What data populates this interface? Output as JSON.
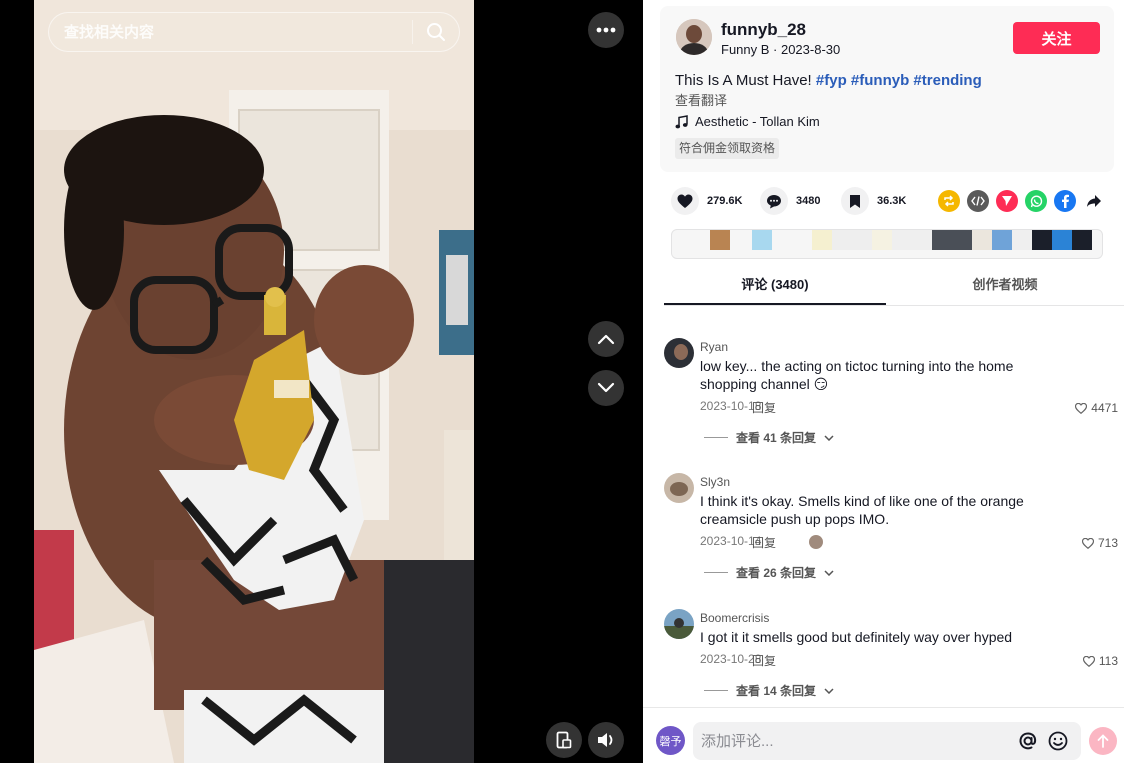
{
  "search": {
    "placeholder": "查找相关内容"
  },
  "author": {
    "id": "funnyb_28",
    "meta": "Funny B · 2023-8-30",
    "follow_label": "关注"
  },
  "post": {
    "desc_text": "This Is A Must Have! ",
    "hashtags": [
      "#fyp",
      "#funnyb",
      "#trending"
    ],
    "translate_label": "查看翻译",
    "music": "Aesthetic - Tollan Kim",
    "badge": "符合佣金领取资格"
  },
  "stats": {
    "likes": "279.6K",
    "comments": "3480",
    "favorites": "36.3K"
  },
  "share_icons": [
    {
      "name": "repost-icon",
      "color": "#f5b700"
    },
    {
      "name": "embed-icon",
      "color": "#5a5a5a"
    },
    {
      "name": "send-icon",
      "color": "#fe2c55"
    },
    {
      "name": "whatsapp-icon",
      "color": "#25d366"
    },
    {
      "name": "facebook-icon",
      "color": "#1877f2"
    }
  ],
  "tabs": {
    "comments": "评论 (3480)",
    "creator_videos": "创作者视频"
  },
  "comments": [
    {
      "user": "Ryan",
      "text": "low key... the acting on tictoc turning into the home shopping channel 😏",
      "date": "2023-10-18",
      "reply_label": "回复",
      "likes": "4471",
      "more": "查看 41 条回复"
    },
    {
      "user": "Sly3n",
      "text": "I think it's okay. Smells kind of like one of the orange creamsicle push up pops IMO.",
      "date": "2023-10-14",
      "reply_label": "回复",
      "likes": "713",
      "more": "查看 26 条回复"
    },
    {
      "user": "Boomercrisis",
      "text": "I got it it smells good but definitely way over hyped",
      "date": "2023-10-28",
      "reply_label": "回复",
      "likes": "113",
      "more": "查看 14 条回复"
    }
  ],
  "composer": {
    "avatar_text": "磬予",
    "placeholder": "添加评论..."
  },
  "colors": {
    "accent": "#fe2c55",
    "hashtag": "#2b5db9"
  }
}
